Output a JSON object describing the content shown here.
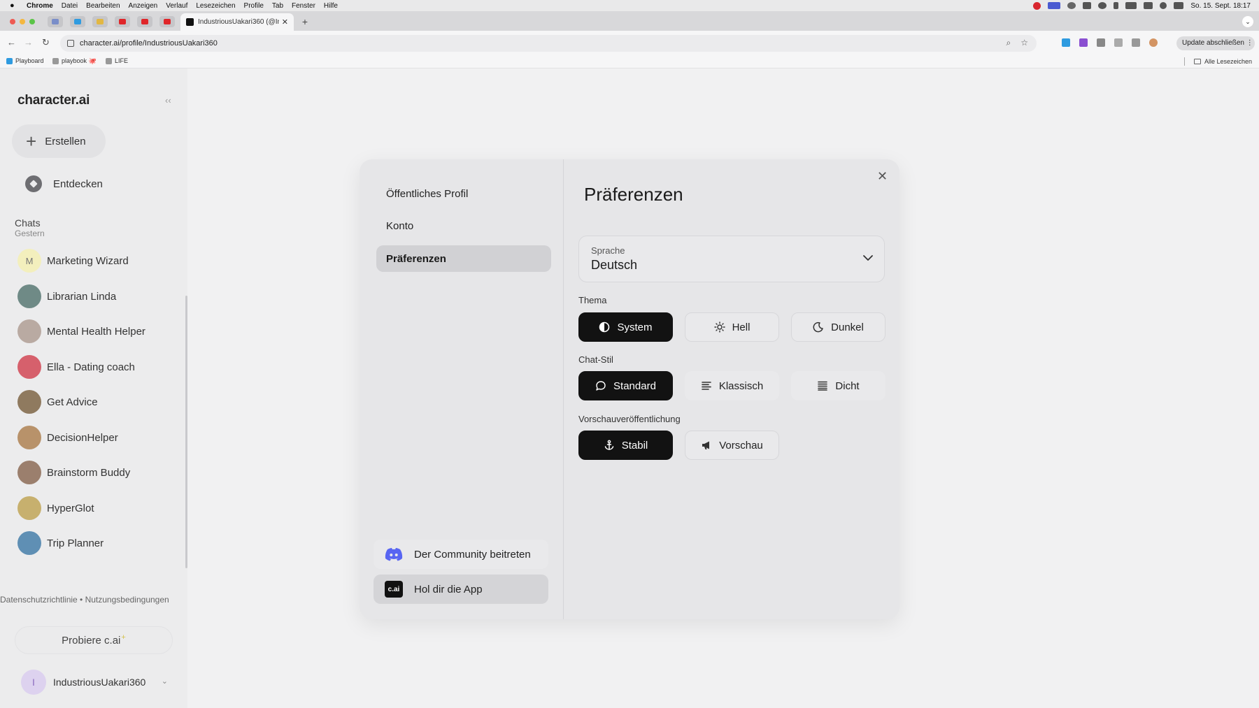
{
  "menubar": {
    "app": "Chrome",
    "items": [
      "Datei",
      "Bearbeiten",
      "Anzeigen",
      "Verlauf",
      "Lesezeichen",
      "Profile",
      "Tab",
      "Fenster",
      "Hilfe"
    ],
    "datetime": "So. 15. Sept. 18:17"
  },
  "browser": {
    "tab_title": "IndustriousUakari360 (@Indu",
    "url": "character.ai/profile/IndustriousUakari360",
    "update_label": "Update abschließen",
    "bookmarks": [
      "Playboard",
      "playbook 🐙",
      "LIFE"
    ],
    "all_bookmarks": "Alle Lesezeichen"
  },
  "sidebar": {
    "logo": "character.ai",
    "create_label": "Erstellen",
    "discover_label": "Entdecken",
    "chats_heading": "Chats",
    "chats_sub": "Gestern",
    "chats": [
      {
        "name": "Marketing Wizard",
        "initial": "M",
        "color": "#f3efbd"
      },
      {
        "name": "Librarian Linda",
        "color": "#6f8a86"
      },
      {
        "name": "Mental Health Helper",
        "color": "#b9aaa2"
      },
      {
        "name": "Ella - Dating coach",
        "color": "#d6606c"
      },
      {
        "name": "Get Advice",
        "color": "#8f7a5f"
      },
      {
        "name": "DecisionHelper",
        "color": "#b8926a"
      },
      {
        "name": "Brainstorm Buddy",
        "color": "#9b7f6d"
      },
      {
        "name": "HyperGlot",
        "color": "#c7b06e"
      },
      {
        "name": "Trip Planner",
        "color": "#5f8fb4"
      }
    ],
    "legal": "Datenschutzrichtlinie  •  Nutzungsbedingungen",
    "try_label": "Probiere  c.ai",
    "try_plus": "+",
    "user_initial": "I",
    "username": "IndustriousUakari360"
  },
  "modal": {
    "nav": [
      "Öffentliches Profil",
      "Konto",
      "Präferenzen"
    ],
    "active_nav": "Präferenzen",
    "community_label": "Der Community beitreten",
    "app_label": "Hol dir die App",
    "app_logo": "c.ai",
    "title": "Präferenzen",
    "language": {
      "label": "Sprache",
      "value": "Deutsch"
    },
    "theme": {
      "label": "Thema",
      "options": [
        "System",
        "Hell",
        "Dunkel"
      ],
      "selected": "System"
    },
    "chat_style": {
      "label": "Chat-Stil",
      "options": [
        "Standard",
        "Klassisch",
        "Dicht"
      ],
      "selected": "Standard"
    },
    "preview": {
      "label": "Vorschauveröffentlichung",
      "options": [
        "Stabil",
        "Vorschau"
      ],
      "selected": "Stabil"
    }
  },
  "colors": {
    "accent_dark": "#121212",
    "discord": "#5865f2"
  }
}
